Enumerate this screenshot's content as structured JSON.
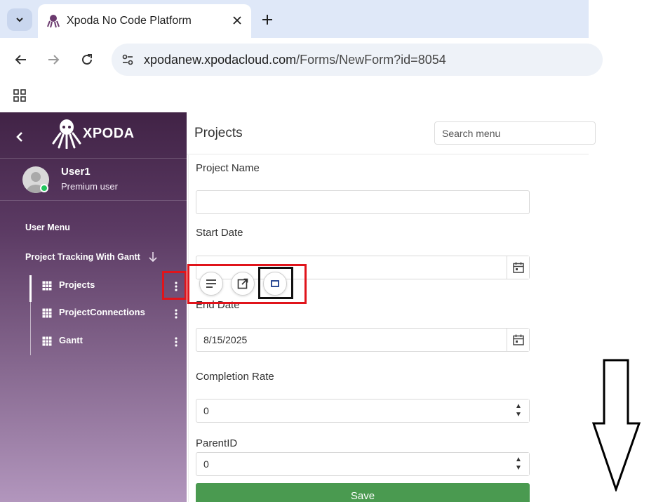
{
  "browser": {
    "tab_title": "Xpoda No Code Platform",
    "url_host": "xpodanew.xpodacloud.com",
    "url_path": "/Forms/NewForm?id=8054",
    "icons": [
      "chevron-down-icon",
      "octopus-favicon-icon",
      "close-icon",
      "plus-icon",
      "back-arrow-icon",
      "forward-arrow-icon",
      "reload-icon",
      "site-info-icon",
      "apps-grid-icon"
    ]
  },
  "sidebar": {
    "brand": "XPODA",
    "user": {
      "name": "User1",
      "role": "Premium user"
    },
    "section_label": "User Menu",
    "group_label": "Project Tracking With Gantt",
    "items": [
      {
        "label": "Projects",
        "active": true
      },
      {
        "label": "ProjectConnections",
        "active": false
      },
      {
        "label": "Gantt",
        "active": false
      }
    ]
  },
  "main": {
    "title": "Projects",
    "search_placeholder": "Search menu",
    "fields": {
      "project_name": {
        "label": "Project Name",
        "value": ""
      },
      "start_date": {
        "label": "Start Date",
        "value": ""
      },
      "end_date": {
        "label": "End Date",
        "value": "8/15/2025"
      },
      "completion_rate": {
        "label": "Completion Rate",
        "value": "0"
      },
      "parent_id": {
        "label": "ParentID",
        "value": "0"
      }
    },
    "save_label": "Save"
  },
  "popup": {
    "buttons": [
      "list-icon",
      "open-external-icon",
      "square-icon"
    ]
  },
  "colors": {
    "sidebar_top": "#412346",
    "sidebar_bottom": "#b296bd",
    "save_button": "#4a9a50",
    "annotation_red": "#e0141b",
    "online_status": "#22c55e"
  }
}
